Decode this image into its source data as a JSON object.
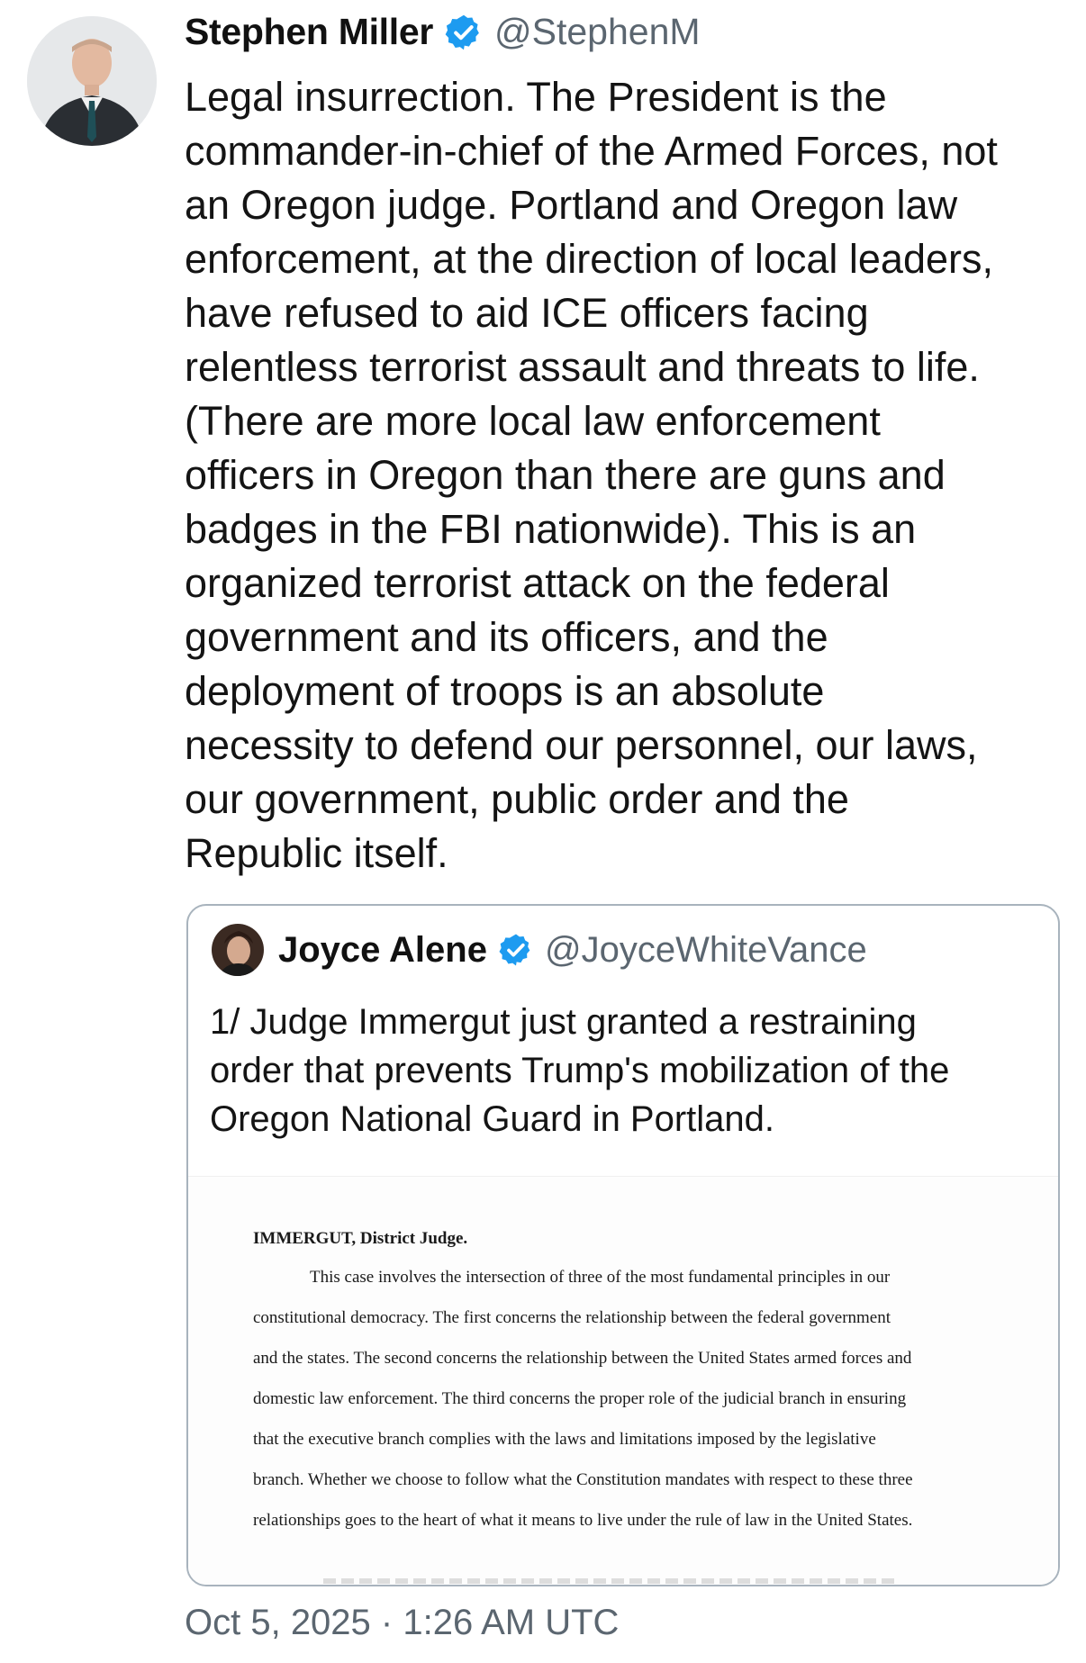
{
  "tweet": {
    "author_name": "Stephen Miller",
    "author_handle": "@StephenM",
    "text": "Legal insurrection. The President is the\ncommander-in-chief of the Armed Forces, not\nan Oregon judge. Portland and Oregon law\nenforcement, at the direction of local leaders,\nhave refused to aid ICE officers facing\nrelentless terrorist assault and threats to life.\n(There are more local law enforcement\nofficers in Oregon than there are guns and\nbadges in the FBI nationwide). This is an\norganized terrorist attack on the federal\ngovernment and its officers, and the\ndeployment of troops is an absolute\nnecessity to defend our personnel, our laws,\nour government, public order and the\nRepublic itself.",
    "timestamp": "Oct 5, 2025 · 1:26 AM UTC"
  },
  "quoted_tweet": {
    "author_name": "Joyce Alene",
    "author_handle": "@JoyceWhiteVance",
    "text": "1/ Judge Immergut just granted a restraining\norder that prevents Trump's mobilization of the\nOregon National Guard in Portland.",
    "document": {
      "heading": "IMMERGUT, District Judge.",
      "lines": [
        "This case involves the intersection of three of the most fundamental principles in our",
        "constitutional democracy. The first concerns the relationship between the federal government",
        "and the states. The second concerns the relationship between the United States armed forces and",
        "domestic law enforcement. The third concerns the proper role of the judicial branch in ensuring",
        "that the executive branch complies with the laws and limitations imposed by the legislative",
        "branch. Whether we choose to follow what the Constitution mandates with respect to these three",
        "relationships goes to the heart of what it means to live under the rule of law in the United States."
      ]
    }
  },
  "icons": {
    "verified": "verified-badge-icon"
  },
  "colors": {
    "verified_blue": "#1d9bf0",
    "muted_text": "#5b6670",
    "card_border": "#a8b3bd"
  }
}
